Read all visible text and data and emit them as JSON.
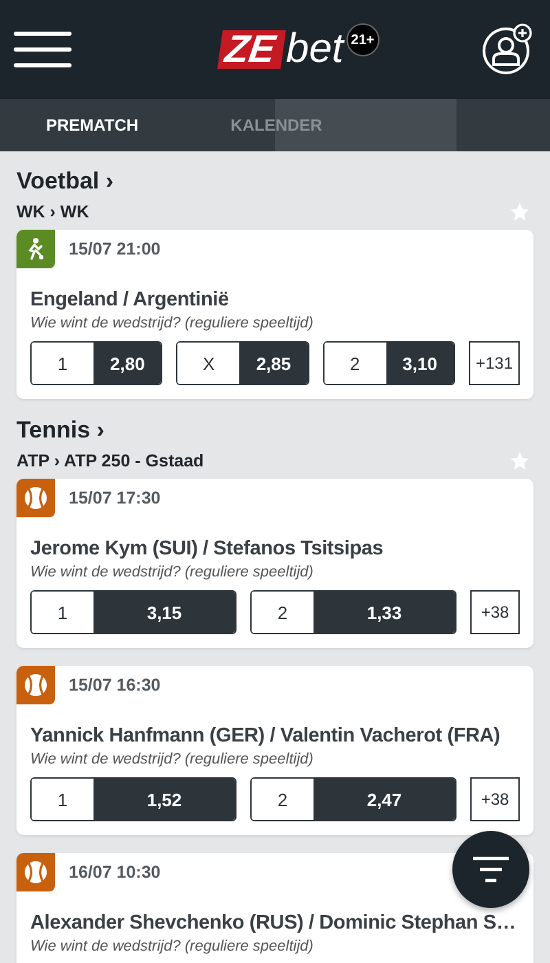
{
  "header": {
    "logo": {
      "mark": "ZE",
      "word": "bet"
    },
    "age_badge": "21+"
  },
  "tabs": [
    {
      "label": "PREMATCH",
      "selected": true
    },
    {
      "label": "KALENDER",
      "selected": false
    }
  ],
  "sections": [
    {
      "title": "Voetbal ›",
      "competition": "WK › WK",
      "favorite": false,
      "matches": [
        {
          "kind": "football",
          "time": "15/07 21:00",
          "title": "Engeland / Argentinië",
          "market": "Wie wint de wedstrijd? (reguliere speeltijd)",
          "outcomes": [
            {
              "label": "1",
              "odds": "2,80"
            },
            {
              "label": "X",
              "odds": "2,85"
            },
            {
              "label": "2",
              "odds": "3,10"
            }
          ],
          "more": "+131"
        }
      ]
    },
    {
      "title": "Tennis ›",
      "competition": "ATP › ATP 250 - Gstaad",
      "favorite": false,
      "matches": [
        {
          "kind": "tennis",
          "time": "15/07 17:30",
          "title": "Jerome Kym (SUI) / Stefanos Tsitsipas",
          "market": "Wie wint de wedstrijd? (reguliere speeltijd)",
          "outcomes": [
            {
              "label": "1",
              "odds": "3,15"
            },
            {
              "label": "2",
              "odds": "1,33"
            }
          ],
          "more": "+38"
        },
        {
          "kind": "tennis",
          "time": "15/07 16:30",
          "title": "Yannick Hanfmann (GER) / Valentin Vacherot (FRA)",
          "market": "Wie wint de wedstrijd? (reguliere speeltijd)",
          "outcomes": [
            {
              "label": "1",
              "odds": "1,52"
            },
            {
              "label": "2",
              "odds": "2,47"
            }
          ],
          "more": "+38"
        },
        {
          "kind": "tennis",
          "time": "16/07 10:30",
          "title": "Alexander Shevchenko (RUS) / Dominic Stephan S…",
          "market": "Wie wint de wedstrijd? (reguliere speeltijd)"
        }
      ]
    }
  ]
}
